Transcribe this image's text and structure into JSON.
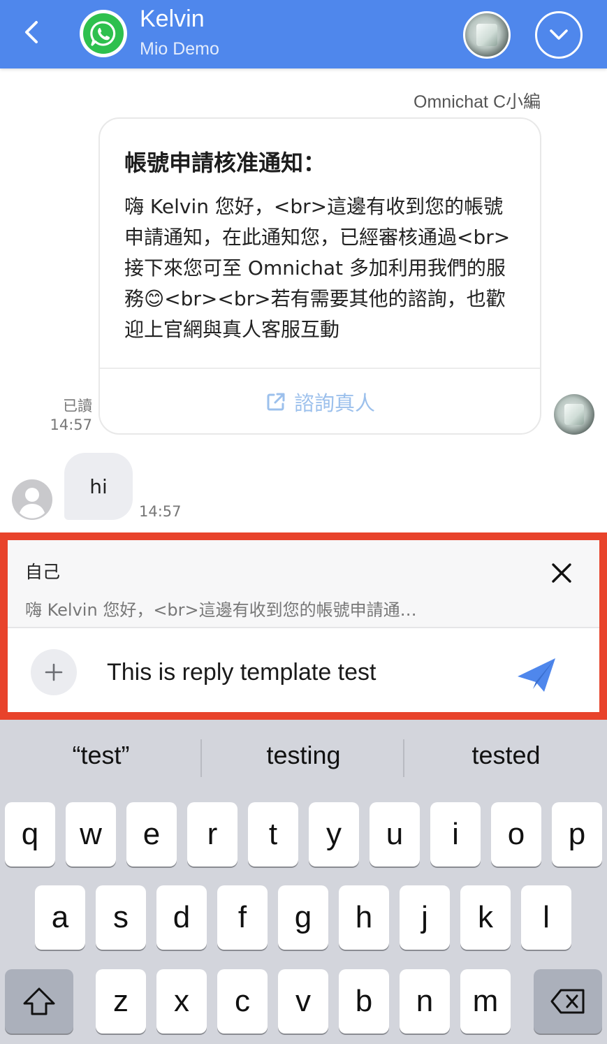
{
  "header": {
    "back_icon": "chevron-left-icon",
    "channel_icon": "whatsapp-icon",
    "contact_name": "Kelvin",
    "contact_subtitle": "Mio Demo",
    "menu_icon": "chevron-down-icon",
    "bg_color": "#4f87ec"
  },
  "messages": {
    "sender_label": "Omnichat C小編",
    "template_card": {
      "title": "帳號申請核准通知：",
      "body": "嗨 Kelvin 您好，<br>這邊有收到您的帳號申請通知，在此通知您，已經審核通過<br>接下來您可至 Omnichat 多加利用我們的服務😊<br><br>若有需要其他的諮詢，也歡迎上官網與真人客服互動",
      "action_label": "諮詢真人",
      "action_icon": "external-link-icon"
    },
    "read_label": "已讀",
    "read_time": "14:57",
    "incoming": {
      "text": "hi",
      "time": "14:57"
    }
  },
  "composer": {
    "quote_author": "自己",
    "quote_text": "嗨 Kelvin 您好，<br>這邊有收到您的帳號申請通…",
    "input_value": "This is reply template test",
    "highlight_color": "#e8432b",
    "send_color": "#4f87ec"
  },
  "keyboard": {
    "suggestions": [
      "“test”",
      "testing",
      "tested"
    ],
    "row1": [
      "q",
      "w",
      "e",
      "r",
      "t",
      "y",
      "u",
      "i",
      "o",
      "p"
    ],
    "row2": [
      "a",
      "s",
      "d",
      "f",
      "g",
      "h",
      "j",
      "k",
      "l"
    ],
    "row3": [
      "z",
      "x",
      "c",
      "v",
      "b",
      "n",
      "m"
    ],
    "shift_icon": "shift-icon",
    "backspace_icon": "backspace-icon"
  }
}
